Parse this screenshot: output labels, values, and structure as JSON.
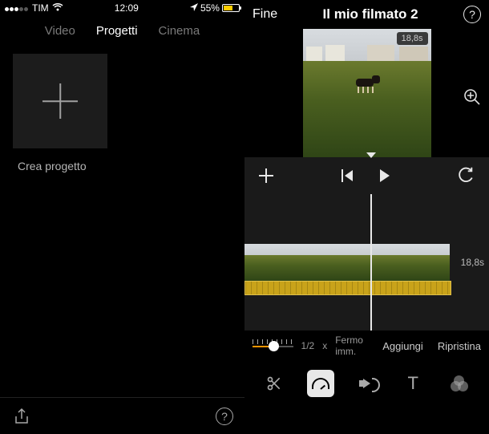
{
  "status": {
    "carrier": "TIM",
    "time": "12:09",
    "battery_pct": "55%"
  },
  "left": {
    "tabs": {
      "video": "Video",
      "progetti": "Progetti",
      "cinema": "Cinema"
    },
    "create_label": "Crea progetto"
  },
  "right": {
    "done": "Fine",
    "title": "Il mio filmato 2",
    "clip_duration": "18,8s",
    "timeline_duration": "18,8s",
    "speed": {
      "value": "1/2",
      "x": "x",
      "freeze": "Fermo imm.",
      "add": "Aggiungi",
      "reset": "Ripristina"
    },
    "tools": {
      "text_label": "T"
    }
  },
  "icons": {
    "plus": "plus",
    "help": "?",
    "export": "export",
    "add_media": "plus",
    "skip_back": "skip-back",
    "play": "play",
    "undo": "undo",
    "zoom": "zoom",
    "scissors": "scissors",
    "speed": "speedometer",
    "volume": "volume",
    "text": "text",
    "filters": "filters"
  }
}
